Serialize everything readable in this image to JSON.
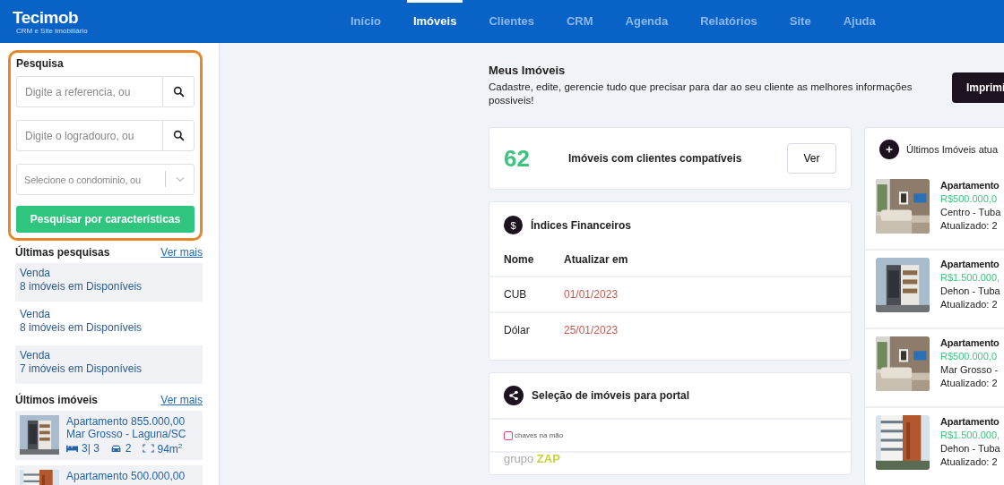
{
  "header": {
    "logo": "Tecimob",
    "logo_tagline": "CRM e Site Imobiliário",
    "nav": [
      {
        "label": "Início",
        "selected": false
      },
      {
        "label": "Imóveis",
        "selected": true
      },
      {
        "label": "Clientes",
        "selected": false
      },
      {
        "label": "CRM",
        "selected": false
      },
      {
        "label": "Agenda",
        "selected": false
      },
      {
        "label": "Relatórios",
        "selected": false
      },
      {
        "label": "Site",
        "selected": false
      },
      {
        "label": "Ajuda",
        "selected": false
      }
    ]
  },
  "sidebar": {
    "search": {
      "title": "Pesquisa",
      "reference_field": {
        "placeholder": "Digite a referencia, ou"
      },
      "street_field": {
        "placeholder": "Digite o logradouro, ou"
      },
      "condo_select": {
        "placeholder": "Selecione o condominio, ou"
      },
      "button": "Pesquisar por características"
    },
    "recent_searches": {
      "title": "Últimas pesquisas",
      "more_link": "Ver mais",
      "items": [
        {
          "type": "Venda",
          "summary": "8 imóveis em Disponíveis"
        },
        {
          "type": "Venda",
          "summary": "8 imóveis em Disponíveis"
        },
        {
          "type": "Venda",
          "summary": "7 imóveis em Disponíveis"
        }
      ]
    },
    "recent_properties": {
      "title": "Últimos imóveis",
      "more_link": "Ver mais",
      "items": [
        {
          "title": "Apartamento 855.000,00",
          "location": "Mar Grosso - Laguna/SC",
          "bedrooms": "3| 3",
          "garages": "2",
          "area": "94m$^{2}$"
        },
        {
          "title": "Apartamento 500.000,00"
        }
      ]
    }
  },
  "intro": {
    "title": "Meus Imóveis",
    "description": "Cadastre, edite, gerencie tudo que precisar para dar ao seu cliente as melhores informações possiveis!",
    "print_button": "Imprimi"
  },
  "match_card": {
    "count": "62",
    "label": "Imóveis com clientes compatíveis",
    "button": "Ver"
  },
  "indices": {
    "icon": "$",
    "title": "Índices Financeiros",
    "columns": [
      "Nome",
      "Atualizar em"
    ],
    "rows": [
      {
        "name": "CUB",
        "date": "01/01/2023"
      },
      {
        "name": "Dólar",
        "date": "25/01/2023"
      }
    ]
  },
  "portals": {
    "title": "Seleção de imóveis para portal",
    "items": [
      {
        "kind": "chaves",
        "label": "chaves na mão"
      },
      {
        "kind": "zap",
        "label": "grupo",
        "accent": "ZAP"
      }
    ]
  },
  "recent_updates": {
    "title": "Últimos Imóveis atua",
    "items": [
      {
        "title": "Apartamento",
        "price": "R$500.000,0",
        "location": "Centro - Tuba",
        "updated": "Atualizado: 2"
      },
      {
        "title": "Apartamento",
        "price": "R$1.500.000,",
        "location": "Dehon - Tuba",
        "updated": "Atualizado: 2"
      },
      {
        "title": "Apartamento",
        "price": "R$500.000,0",
        "location": "Mar Grosso -",
        "updated": "Atualizado: 2"
      },
      {
        "title": "Apartamento",
        "price": "R$1.500.000,",
        "location": "Dehon - Tuba",
        "updated": "Atualizado: 2"
      }
    ]
  }
}
